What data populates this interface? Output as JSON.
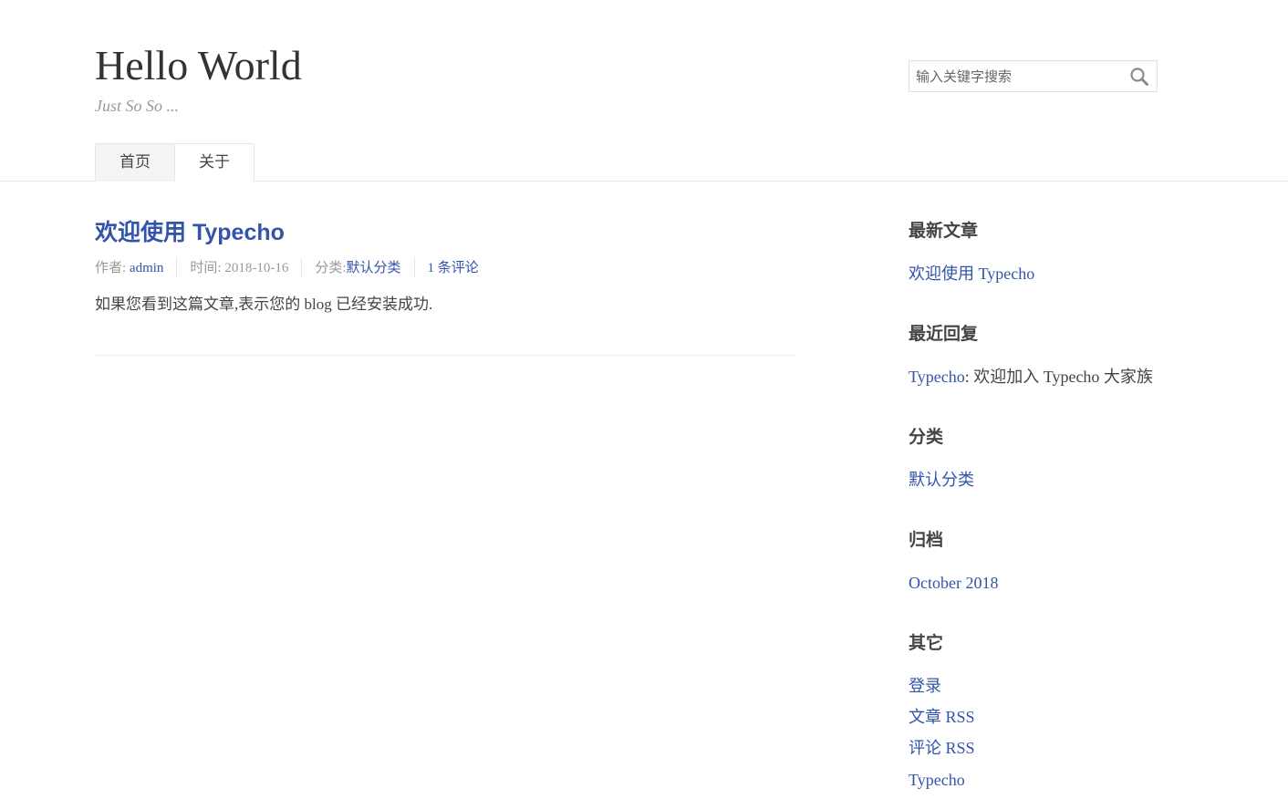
{
  "header": {
    "site_title": "Hello World",
    "site_description": "Just So So ...",
    "search": {
      "placeholder": "输入关键字搜索",
      "value": ""
    }
  },
  "nav": {
    "items": [
      {
        "label": "首页",
        "current": true
      },
      {
        "label": "关于",
        "current": false
      }
    ]
  },
  "post": {
    "title": "欢迎使用 Typecho",
    "meta": {
      "author_label": "作者:",
      "author": "admin",
      "time_label": "时间:",
      "time": "2018-10-16",
      "category_label": "分类:",
      "category": "默认分类",
      "comments": "1 条评论"
    },
    "content": "如果您看到这篇文章,表示您的 blog 已经安装成功."
  },
  "sidebar": {
    "recent_posts": {
      "title": "最新文章",
      "items": [
        "欢迎使用 Typecho"
      ]
    },
    "recent_comments": {
      "title": "最近回复",
      "items": [
        {
          "author": "Typecho",
          "text": ": 欢迎加入 Typecho 大家族"
        }
      ]
    },
    "categories": {
      "title": "分类",
      "items": [
        "默认分类"
      ]
    },
    "archives": {
      "title": "归档",
      "items": [
        "October 2018"
      ]
    },
    "other": {
      "title": "其它",
      "items": [
        "登录",
        "文章 RSS",
        "评论 RSS",
        "Typecho"
      ]
    }
  },
  "colors": {
    "link": "#3354AA",
    "text": "#444444",
    "muted": "#999999",
    "border": "#e6e6e6"
  }
}
